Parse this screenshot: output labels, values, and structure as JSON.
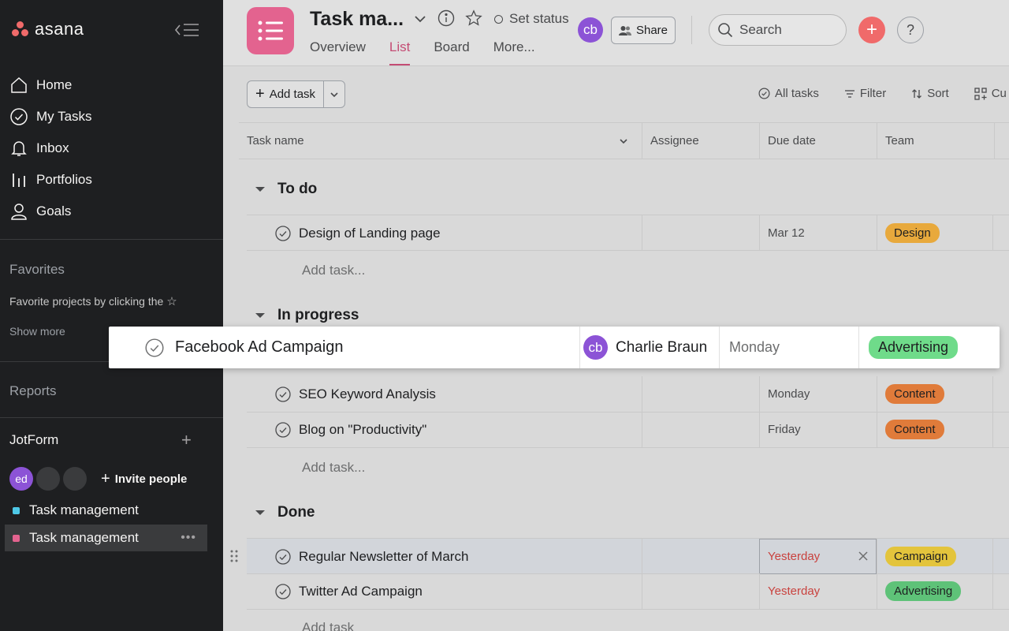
{
  "sidebar": {
    "logo_text": "asana",
    "nav": [
      {
        "label": "Home",
        "icon": "home-icon"
      },
      {
        "label": "My Tasks",
        "icon": "check-circle-icon"
      },
      {
        "label": "Inbox",
        "icon": "bell-icon"
      },
      {
        "label": "Portfolios",
        "icon": "bar-chart-icon"
      },
      {
        "label": "Goals",
        "icon": "person-icon"
      }
    ],
    "favorites_title": "Favorites",
    "favorites_hint": "Favorite projects by clicking the",
    "show_more": "Show more",
    "reports": "Reports",
    "team": "JotForm",
    "member_initials": "ed",
    "invite": "Invite people",
    "projects": [
      {
        "label": "Task management",
        "color": "#4ec8e6"
      },
      {
        "label": "Task management",
        "color": "#e3638f"
      }
    ]
  },
  "header": {
    "title": "Task ma...",
    "set_status": "Set status",
    "avatar_initials": "cb",
    "share": "Share",
    "search_placeholder": "Search",
    "help": "?",
    "tabs": [
      "Overview",
      "List",
      "Board",
      "More..."
    ],
    "active_tab": "List"
  },
  "toolbar": {
    "add_task": "Add task",
    "all_tasks": "All tasks",
    "filter": "Filter",
    "sort": "Sort",
    "customize": "Cu"
  },
  "columns": {
    "task_name": "Task name",
    "assignee": "Assignee",
    "due_date": "Due date",
    "team": "Team"
  },
  "sections": {
    "todo": {
      "title": "To do",
      "rows": [
        {
          "name": "Design of Landing page",
          "due": "Mar 12",
          "tag": "Design",
          "tag_color": "#e8a93c"
        }
      ],
      "add": "Add task..."
    },
    "inprogress": {
      "title": "In progress",
      "rows": [
        {
          "name": "SEO Keyword Analysis",
          "due": "Monday",
          "tag": "Content",
          "tag_color": "#e07b3a"
        },
        {
          "name": "Blog on \"Productivity\"",
          "due": "Friday",
          "tag": "Content",
          "tag_color": "#e07b3a"
        }
      ],
      "add": "Add task..."
    },
    "done": {
      "title": "Done",
      "rows": [
        {
          "name": "Regular Newsletter of March",
          "due": "Yesterday",
          "tag": "Campaign",
          "tag_color": "#e3c43c"
        },
        {
          "name": "Twitter Ad Campaign",
          "due": "Yesterday",
          "tag": "Advertising",
          "tag_color": "#5ec278"
        }
      ],
      "add": "Add task"
    }
  },
  "dragged": {
    "name": "Facebook Ad Campaign",
    "assignee_initials": "cb",
    "assignee": "Charlie Braun",
    "due": "Monday",
    "tag": "Advertising",
    "tag_color": "#6fdb8a"
  }
}
